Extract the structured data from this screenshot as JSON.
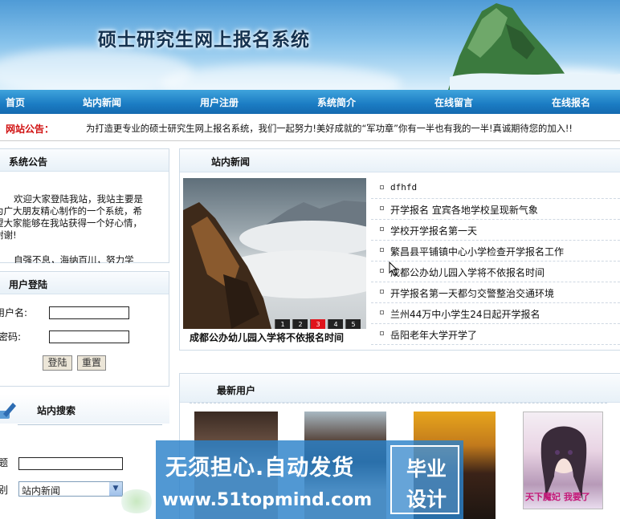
{
  "banner": {
    "title": "硕士研究生网上报名系统"
  },
  "nav": {
    "items": [
      "首页",
      "站内新闻",
      "用户注册",
      "系统简介",
      "在线留言",
      "在线报名"
    ]
  },
  "notice": {
    "tag": "网站公告：",
    "text": "为打造更专业的硕士研究生网上报名系统，我们一起努力!美好成就的“军功章”你有一半也有我的一半!真诚期待您的加入!!"
  },
  "announce": {
    "title": "系统公告",
    "body": "欢迎大家登陆我站，我站主要是为广大朋友精心制作的一个系统，希望大家能够在我站获得一个好心情，谢谢!",
    "body2": "自强不息，海纳百川，努力学"
  },
  "login": {
    "title": "用户登陆",
    "username_label": "用户名:",
    "password_label": "密码:",
    "username_value": "",
    "password_value": "",
    "login_button": "登陆",
    "reset_button": "重置"
  },
  "search": {
    "title": "站内搜索",
    "keyword_label": "题",
    "keyword_value": "",
    "type_label": "别",
    "type_selected": "站内新闻"
  },
  "news": {
    "title": "站内新闻",
    "caption": "成都公办幼儿园入学将不依报名时间",
    "pager": [
      "1",
      "2",
      "3",
      "4",
      "5"
    ],
    "active_page": "3",
    "items": [
      "dfhfd",
      "开学报名 宜宾各地学校呈现新气象",
      "学校开学报名第一天",
      "繁昌县平铺镇中心小学检查开学报名工作",
      "成都公办幼儿园入学将不依报名时间",
      "开学报名第一天都匀交警整治交通环境",
      "兰州44万中小学生24日起开学报名",
      "岳阳老年大学开学了"
    ]
  },
  "users": {
    "title": "最新用户",
    "last_avatar_caption": "天下魔妃  我要了"
  },
  "watermark": {
    "line1": "无须担心.自动发货",
    "line2": "www.51topmind.com",
    "box_top": "毕业",
    "box_bottom": "设计"
  },
  "colors": {
    "nav": "#1b7cc3",
    "notice_tag": "#d01010",
    "pager_active": "#e0141b"
  }
}
